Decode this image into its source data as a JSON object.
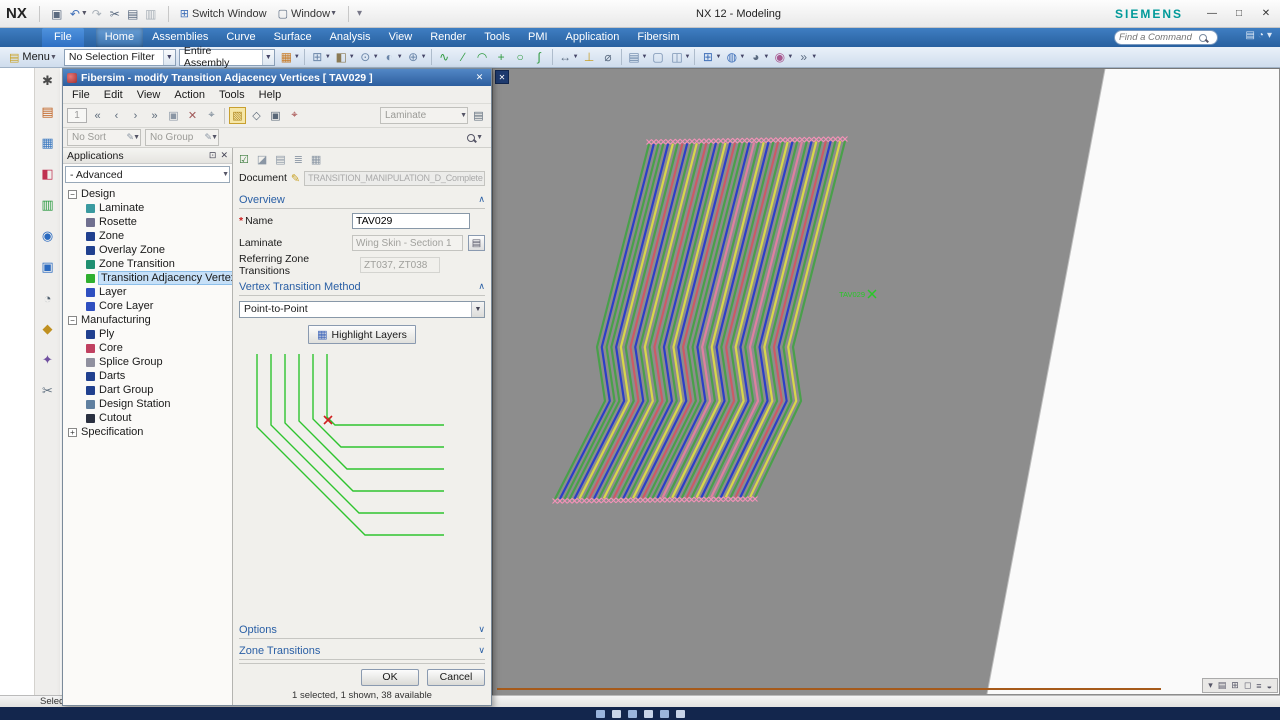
{
  "titlebar": {
    "logo": "NX",
    "title": "NX 12 - Modeling",
    "brand": "SIEMENS",
    "switch_window_label": "Switch Window",
    "window_menu_label": "Window",
    "icons": [
      {
        "name": "save-icon",
        "glyph": "▣",
        "color": "#5a6a80"
      },
      {
        "name": "undo-icon",
        "glyph": "↶",
        "color": "#3f6fb8",
        "caret": true
      },
      {
        "name": "redo-icon",
        "glyph": "↷",
        "color": "#a8b0b8"
      },
      {
        "name": "cut-icon",
        "glyph": "✂",
        "color": "#5a6a80"
      },
      {
        "name": "copy-icon",
        "glyph": "▤",
        "color": "#5a6a80"
      },
      {
        "name": "paste-icon",
        "glyph": "▥",
        "color": "#a8b0b8"
      }
    ]
  },
  "ribbon": {
    "tabs": [
      {
        "label": "File",
        "file": true
      },
      {
        "label": "Home",
        "active": true
      },
      {
        "label": "Assemblies"
      },
      {
        "label": "Curve"
      },
      {
        "label": "Surface"
      },
      {
        "label": "Analysis"
      },
      {
        "label": "View"
      },
      {
        "label": "Render"
      },
      {
        "label": "Tools"
      },
      {
        "label": "PMI"
      },
      {
        "label": "Application"
      },
      {
        "label": "Fibersim"
      }
    ],
    "find_command_placeholder": "Find a Command",
    "right_icons": [
      {
        "name": "command-list-icon",
        "glyph": "▤"
      },
      {
        "name": "user-interface-icon",
        "glyph": "◔"
      },
      {
        "name": "minimize-ribbon-icon",
        "glyph": "▾"
      }
    ]
  },
  "toolbar": {
    "menu_label": "Menu",
    "selection_filter_value": "No Selection Filter",
    "scope_value": "Entire Assembly",
    "icons": [
      {
        "name": "direct-sketch-icon",
        "glyph": "▦",
        "color": "#c87c28",
        "caret": true
      },
      {
        "sep": true
      },
      {
        "name": "datum-plane-icon",
        "glyph": "⊞",
        "color": "#6a85a8",
        "caret": true
      },
      {
        "name": "extrude-icon",
        "glyph": "◧",
        "color": "#8a7a55",
        "caret": true
      },
      {
        "name": "hole-icon",
        "glyph": "⊙",
        "color": "#6a85a8",
        "caret": true
      },
      {
        "name": "edge-blend-icon",
        "glyph": "◐",
        "color": "#6a85a8",
        "caret": true
      },
      {
        "name": "unite-icon",
        "glyph": "⊕",
        "color": "#6a85a8",
        "caret": true
      },
      {
        "sep": true
      },
      {
        "name": "profile-icon",
        "glyph": "∿",
        "color": "#2f9a3f"
      },
      {
        "name": "line-icon",
        "glyph": "∕",
        "color": "#2f9a3f"
      },
      {
        "name": "arc-icon",
        "glyph": "◠",
        "color": "#2f9a3f"
      },
      {
        "name": "point-icon",
        "glyph": "+",
        "color": "#2f9a3f"
      },
      {
        "name": "circle-icon",
        "glyph": "○",
        "color": "#2f9a3f"
      },
      {
        "name": "spline-icon",
        "glyph": "∫",
        "color": "#2f9a3f"
      },
      {
        "sep": true
      },
      {
        "name": "rapid-dimension-icon",
        "glyph": "↔",
        "color": "#5a6a80",
        "caret": true
      },
      {
        "name": "datum-csys-icon",
        "glyph": "⊥",
        "color": "#c8a028"
      },
      {
        "name": "measure-icon",
        "glyph": "⌀",
        "color": "#5a6a80"
      },
      {
        "sep": true
      },
      {
        "name": "pattern-feature-icon",
        "glyph": "▤",
        "color": "#6a85a8",
        "caret": true
      },
      {
        "name": "shell-icon",
        "glyph": "▢",
        "color": "#6a85a8"
      },
      {
        "name": "trim-body-icon",
        "glyph": "◫",
        "color": "#6a85a8",
        "caret": true
      },
      {
        "sep": true
      },
      {
        "name": "window-layout-icon",
        "glyph": "⊞",
        "color": "#3f6fb8",
        "caret": true
      },
      {
        "name": "view-orient-icon",
        "glyph": "◍",
        "color": "#3f6fb8",
        "caret": true
      },
      {
        "name": "render-style-icon",
        "glyph": "◕",
        "color": "#5a6a80",
        "caret": true
      },
      {
        "name": "palette-icon",
        "glyph": "◉",
        "color": "#a85890",
        "caret": true
      },
      {
        "name": "more-tools-icon",
        "glyph": "»",
        "color": "#5a6a80",
        "caret": true
      }
    ]
  },
  "resource_bar": {
    "icons": [
      {
        "name": "roles-gear-icon",
        "glyph": "✱",
        "color": "#4a4a4a"
      },
      {
        "name": "assembly-navigator-icon",
        "glyph": "▤",
        "color": "#c06020"
      },
      {
        "name": "constraint-navigator-icon",
        "glyph": "▦",
        "color": "#3a78c0"
      },
      {
        "name": "part-navigator-icon",
        "glyph": "◧",
        "color": "#c03050"
      },
      {
        "name": "reuse-library-icon",
        "glyph": "▥",
        "color": "#2a9a40"
      },
      {
        "name": "hd3d-tools-icon",
        "glyph": "◉",
        "color": "#2a6ac0"
      },
      {
        "name": "web-browser-icon",
        "glyph": "▣",
        "color": "#2a6ac0"
      },
      {
        "name": "history-icon",
        "glyph": "◔",
        "color": "#506070"
      },
      {
        "name": "process-studio-icon",
        "glyph": "◆",
        "color": "#c09020"
      },
      {
        "name": "wizards-icon",
        "glyph": "✦",
        "color": "#7050a0"
      },
      {
        "name": "snips-icon",
        "glyph": "✂",
        "color": "#607080"
      }
    ]
  },
  "dialog": {
    "title": "Fibersim - modify Transition Adjacency Vertices [ TAV029 ]",
    "menus": [
      "File",
      "Edit",
      "View",
      "Action",
      "Tools",
      "Help"
    ],
    "toolbar": {
      "page_value": "1",
      "nav_icons": [
        {
          "name": "first-record-icon",
          "glyph": "«",
          "color": "#5a6878"
        },
        {
          "name": "prev-record-icon",
          "glyph": "‹",
          "color": "#5a6878"
        },
        {
          "name": "next-record-icon",
          "glyph": "›",
          "color": "#5a6878"
        },
        {
          "name": "last-record-icon",
          "glyph": "»",
          "color": "#5a6878"
        },
        {
          "name": "copy-record-icon",
          "glyph": "▣",
          "color": "#8a96a4"
        },
        {
          "name": "delete-record-icon",
          "glyph": "✕",
          "color": "#a05858"
        },
        {
          "name": "pin-record-icon",
          "glyph": "⌖",
          "color": "#708090"
        }
      ],
      "view_icons": [
        {
          "name": "solid-view-icon",
          "glyph": "▧",
          "color": "#b08820",
          "active": true
        },
        {
          "name": "wireframe-view-icon",
          "glyph": "◇",
          "color": "#5a6878"
        },
        {
          "name": "snapshot-icon",
          "glyph": "▣",
          "color": "#5a6878"
        },
        {
          "name": "tag-icon",
          "glyph": "⌖",
          "color": "#a04040"
        }
      ],
      "laminate_combo_label": "Laminate",
      "form_icon_glyph": "▤"
    },
    "sort_value": "No Sort",
    "group_value": "No Group",
    "nav": {
      "title": "Applications",
      "mode_value": "- Advanced",
      "groups": [
        {
          "label": "Design",
          "expanded": true,
          "items": [
            {
              "label": "Laminate",
              "color": "#3a9aa0"
            },
            {
              "label": "Rosette",
              "color": "#707090"
            },
            {
              "label": "Zone",
              "color": "#20408f"
            },
            {
              "label": "Overlay Zone",
              "color": "#20408f"
            },
            {
              "label": "Zone Transition",
              "color": "#1f8f70"
            },
            {
              "label": "Transition Adjacency Vertex",
              "color": "#2faf2f",
              "selected": true
            },
            {
              "label": "Layer",
              "color": "#2f4fc0"
            },
            {
              "label": "Core Layer",
              "color": "#2f4fc0"
            }
          ]
        },
        {
          "label": "Manufacturing",
          "expanded": true,
          "items": [
            {
              "label": "Ply",
              "color": "#20408f"
            },
            {
              "label": "Core",
              "color": "#c04060"
            },
            {
              "label": "Splice Group",
              "color": "#90909f"
            },
            {
              "label": "Darts",
              "color": "#20408f"
            },
            {
              "label": "Dart Group",
              "color": "#20408f"
            },
            {
              "label": "Design Station",
              "color": "#6080a0"
            },
            {
              "label": "Cutout",
              "color": "#2a3040"
            }
          ]
        },
        {
          "label": "Specification",
          "expanded": false,
          "items": []
        }
      ]
    },
    "detail": {
      "icons": [
        {
          "name": "select-all-checkbox-icon",
          "glyph": "☑"
        },
        {
          "name": "highlight-icon",
          "glyph": "◪"
        },
        {
          "name": "note-icon",
          "glyph": "▤"
        },
        {
          "name": "list-view-icon",
          "glyph": "≣"
        },
        {
          "name": "table-view-icon",
          "glyph": "▦"
        }
      ],
      "document_label": "Document",
      "document_value": "TRANSITION_MANIPULATION_D_Complete",
      "overview_header": "Overview",
      "name_label": "Name",
      "name_value": "TAV029",
      "laminate_label": "Laminate",
      "laminate_value": "Wing Skin - Section 1",
      "referring_label": "Referring Zone Transitions",
      "referring_value": "ZT037, ZT038",
      "method_header": "Vertex Transition Method",
      "method_value": "Point-to-Point",
      "highlight_button_label": "Highlight Layers",
      "options_header": "Options",
      "zone_transitions_header": "Zone Transitions",
      "ok_label": "OK",
      "cancel_label": "Cancel",
      "status_text": "1 selected, 1 shown, 38 available"
    },
    "diagram": {
      "line_color": "#2fc42f",
      "marker_color": "#d02020"
    }
  },
  "canvas": {
    "background": "#8d8d8d",
    "surface_edge_color": "#fafafa",
    "base_line_color": "#a65a1a",
    "marker_color": "#f492b8",
    "vertex_color": "#28c828",
    "vertex_label": "TAV029",
    "stripe_colors": [
      "#49a04a",
      "#2c3ec8",
      "#49a04a",
      "#49a04a",
      "#2c3ec8",
      "#d8d84a",
      "#49a04a",
      "#cc5a66",
      "#2c3ec8",
      "#49a04a",
      "#d8d84a",
      "#49a04a",
      "#cc5a66",
      "#49a04a",
      "#2c3ec8",
      "#49a04a",
      "#d8d84a",
      "#2c3ec8",
      "#cc5a66",
      "#49a04a",
      "#49a04a",
      "#2c3ec8",
      "#e080a0",
      "#49a04a",
      "#d8d84a",
      "#2c3ec8",
      "#49a04a",
      "#cc5a66",
      "#49a04a",
      "#d8d84a",
      "#2c3ec8",
      "#49a04a",
      "#e080a0",
      "#49a04a",
      "#2c3ec8",
      "#d8d84a",
      "#49a04a",
      "#cc5a66",
      "#2c3ec8",
      "#49a04a",
      "#d8d84a",
      "#49a04a"
    ],
    "mini_tray_icons": [
      "▾",
      "▤",
      "⊞",
      "◻",
      "≡",
      "◒"
    ]
  },
  "statusbar": {
    "select_label": "Select"
  },
  "taskbar": {
    "icon_colors": [
      "#9ab4dc",
      "#c8d4e8",
      "#9ab4dc",
      "#c8d4e8",
      "#9ab4dc",
      "#c8d4e8"
    ]
  }
}
